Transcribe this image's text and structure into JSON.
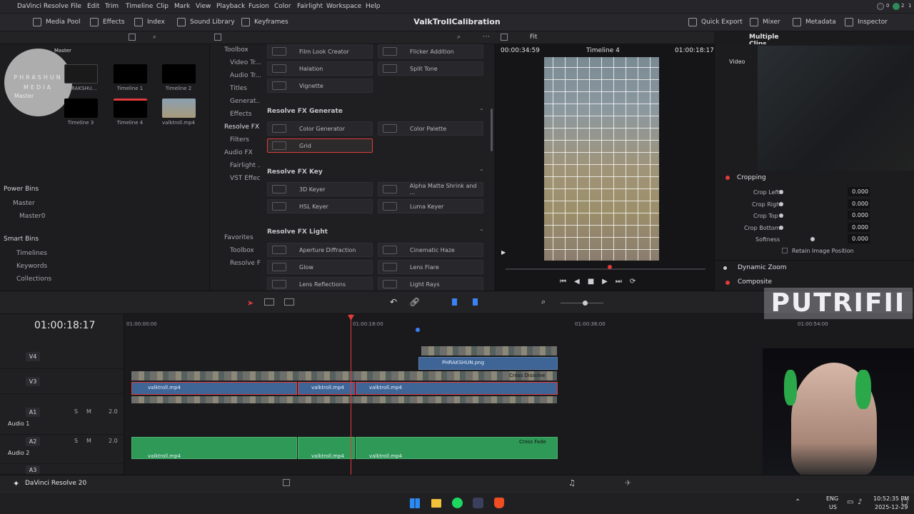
{
  "menubar": {
    "app": "DaVinci Resolve",
    "items": [
      "File",
      "Edit",
      "Trim",
      "Timeline",
      "Clip",
      "Mark",
      "View",
      "Playback",
      "Fusion",
      "Color",
      "Fairlight",
      "Workspace",
      "Help"
    ],
    "notif_counts": [
      "0",
      "2",
      "1"
    ]
  },
  "toolbar": {
    "media_pool": "Media Pool",
    "effects": "Effects",
    "index": "Index",
    "sound_library": "Sound Library",
    "keyframes": "Keyframes",
    "project_name": "ValkTrollCalibration",
    "quick_export": "Quick Export",
    "mixer": "Mixer",
    "metadata": "Metadata",
    "inspector": "Inspector"
  },
  "logo": {
    "line1": "PHRASHUN",
    "line2": "MEDIA",
    "master_left": "Master",
    "master_right": "Master"
  },
  "media_pool": {
    "clips": [
      {
        "label": "PHRAKSHU...",
        "dark": false
      },
      {
        "label": "Timeline 1",
        "dark": true
      },
      {
        "label": "Timeline 2",
        "dark": true
      },
      {
        "label": "Timeline 3",
        "dark": true
      },
      {
        "label": "Timeline 4",
        "dark": true
      },
      {
        "label": "valktroll.mp4",
        "dark": false
      }
    ],
    "power_bins": "Power Bins",
    "master": "Master",
    "master0": "Master0",
    "smart_bins": "Smart Bins",
    "smart_items": [
      "Timelines",
      "Keywords",
      "Collections"
    ]
  },
  "fx_tree": {
    "items": [
      "Toolbox",
      "Video Tr...",
      "Audio Tr...",
      "Titles",
      "Generat...",
      "Effects",
      "Resolve FX",
      "Filters",
      "Audio FX",
      "Fairlight ...",
      "VST Effects",
      "Favorites",
      "Toolbox",
      "Resolve FX"
    ]
  },
  "fx_list": {
    "row0": [
      "Film Look Creator",
      "Flicker Addition"
    ],
    "row1": [
      "Halation",
      "Split Tone"
    ],
    "row2": [
      "Vignette"
    ],
    "generate_header": "Resolve FX Generate",
    "generate": [
      "Color Generator",
      "Color Palette",
      "Grid"
    ],
    "key_header": "Resolve FX Key",
    "key": [
      "3D Keyer",
      "Alpha Matte Shrink and ...",
      "HSL Keyer",
      "Luma Keyer"
    ],
    "light_header": "Resolve FX Light",
    "light": [
      "Aperture Diffraction",
      "Cinematic Haze",
      "Glow",
      "Lens Flare",
      "Lens Reflections",
      "Light Rays"
    ]
  },
  "viewer": {
    "fit": "Fit",
    "timecode_left": "00:00:34:59",
    "timeline_name": "Timeline 4",
    "timecode_right": "01:00:18:17"
  },
  "inspector": {
    "title": "Multiple Clips",
    "video_tab": "Video",
    "cropping": "Cropping",
    "fields": [
      {
        "label": "Crop Left",
        "value": "0.000"
      },
      {
        "label": "Crop Right",
        "value": "0.000"
      },
      {
        "label": "Crop Top",
        "value": "0.000"
      },
      {
        "label": "Crop Bottom",
        "value": "0.000"
      },
      {
        "label": "Softness",
        "value": "0.000"
      }
    ],
    "retain": "Retain Image Position",
    "dynamic_zoom": "Dynamic Zoom",
    "composite": "Composite"
  },
  "watermark": "PUTRIFII",
  "timeline": {
    "timecode": "01:00:18:17",
    "ruler": [
      "01:00:00:00",
      "01:00:18:00",
      "01:00:36:00",
      "01:00:54:00"
    ],
    "tracks": [
      {
        "id": "V4",
        "name": ""
      },
      {
        "id": "V3",
        "name": ""
      },
      {
        "id": "A1",
        "name": "Audio 1",
        "level": "2.0"
      },
      {
        "id": "A2",
        "name": "Audio 2",
        "level": "2.0"
      },
      {
        "id": "A3",
        "name": ""
      }
    ],
    "clip_labels": {
      "phrakshun": "PHRAKSHUN.png",
      "v1": "valktroll.mp4",
      "v2": "valktroll.mp4",
      "v3": "valktroll.mp4",
      "a1": "valktroll.mp4",
      "a2": "valktroll.mp4",
      "a3": "valktroll.mp4",
      "cross": "Cross Dissolve",
      "crossfade": "Cross Fade"
    }
  },
  "pagebar": {
    "app_name": "DaVinci Resolve 20"
  },
  "taskbar": {
    "lang": "ENG",
    "region": "US",
    "time": "10:52:35 PM",
    "date": "2025-12-29"
  },
  "colors": {
    "accent_red": "#e23b3b",
    "video_clip": "#3e6596",
    "audio_clip": "#2f9a57",
    "playhead": "#e23b3b"
  }
}
